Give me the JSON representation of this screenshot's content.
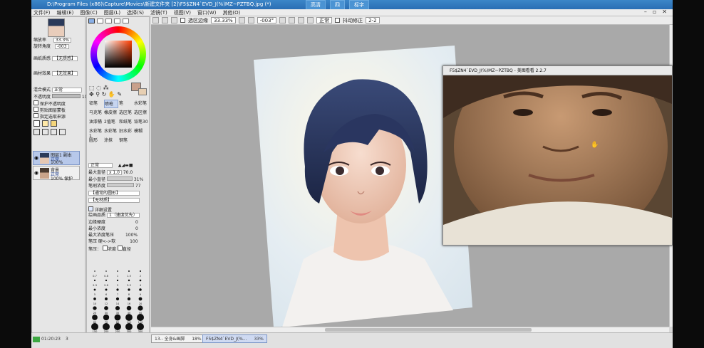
{
  "window": {
    "title": "D:\\Program Files (x86)\\Capture\\Movies\\新建文件夹 [2]\\F5$ZN4`EVD_J(%)MZ~PZTBQ.jpg (*)",
    "buttons": [
      "高清",
      "四",
      "标字"
    ]
  },
  "menu": [
    "文件(F)",
    "编辑(E)",
    "图像(C)",
    "图层(L)",
    "选择(S)",
    "滤镜(T)",
    "视图(V)",
    "窗口(W)",
    "其他(O)"
  ],
  "toolbar": {
    "select_edge_label": "选区边缘",
    "zoom": "33.33%",
    "angle": "-003°",
    "blend": "正常",
    "stabilizer_label": "抖动修正",
    "stabilizer_value": "2-2"
  },
  "left_panel": {
    "zoom_label": "缩放率",
    "zoom_value": "33.3%",
    "angle_label": "旋转角度",
    "angle_value": "-003",
    "paper_label": "画纸质感",
    "paper_value": "【无质感】",
    "effect_label": "画材效果",
    "effect_value": "【无效果】",
    "blend_label": "混合模式",
    "blend_value": "正常",
    "opacity_label": "不透明度",
    "opacity_value": "100%",
    "checks": [
      "保护不透明度",
      "剪贴图层蒙板",
      "指定选取来源"
    ],
    "layers": [
      {
        "name": "图层1 副本",
        "mode": "正常",
        "opacity": "100%"
      },
      {
        "name": "背景",
        "mode": "正常",
        "opacity": "100% 保护"
      }
    ]
  },
  "tool_panel": {
    "tools": [
      "铅笔",
      "喷枪",
      "笔",
      "水彩笔",
      "马克笔",
      "橡皮擦",
      "选区笔",
      "选区擦",
      "油漆桶",
      "2值笔",
      "和纸笔",
      "铅笔30",
      "水彩笔1",
      "水彩笔",
      "旧水彩",
      "模糊",
      "圆形",
      "涂抹",
      "钢笔"
    ],
    "blend_value": "正常",
    "max_size_label": "最大直径",
    "max_size_mult": "x 1.0",
    "max_size_value": "70.0",
    "min_size_label": "最小直径",
    "min_size_value": "31%",
    "density_label": "笔刷浓度",
    "density_value": "77",
    "shape_value": "【通常的圆形】",
    "texture_value": "【无材质】",
    "detail_label": "详细设置",
    "quality_label": "绘画品质",
    "quality_value": "1（速度优先）",
    "edge_label": "边缘硬度",
    "edge_value": "0",
    "min_density_label": "最小浓度",
    "min_density_value": "0",
    "max_pressure_label": "最大浓度笔压",
    "max_pressure_value": "100%",
    "pressure_label": "笔压 硬<->软",
    "pressure_value": "100",
    "pressure_opts": "笔压：",
    "pressure_density": "浓度",
    "pressure_size": "直径",
    "brush_sizes": [
      "0.7",
      "0.8",
      "1",
      "1.5",
      "2",
      "2.3",
      "2.6",
      "3",
      "3.5",
      "4",
      "5",
      "6",
      "7",
      "8",
      "9",
      "10",
      "12",
      "14",
      "16",
      "20",
      "25",
      "30",
      "35",
      "40",
      "50",
      "60",
      "70",
      "80",
      "100",
      "120",
      "150",
      "200",
      "250",
      "300",
      "350",
      "400",
      "500"
    ]
  },
  "popup": {
    "title": "F5$ZN4`EVD_J(%)MZ~PZTBQ - 美图看看 2.2.7"
  },
  "status": {
    "time": "01:20:23",
    "count": "3",
    "tab1": "13.- 全身&画脚",
    "tab1_pct": "18%",
    "tab2": "F5$ZN4`EVD_J(%...",
    "tab2_pct": "33%"
  },
  "colors": {
    "titlebar": "#2f78bc",
    "canvas_bg": "#a9a9a9",
    "current_color": "#c9a08c"
  }
}
